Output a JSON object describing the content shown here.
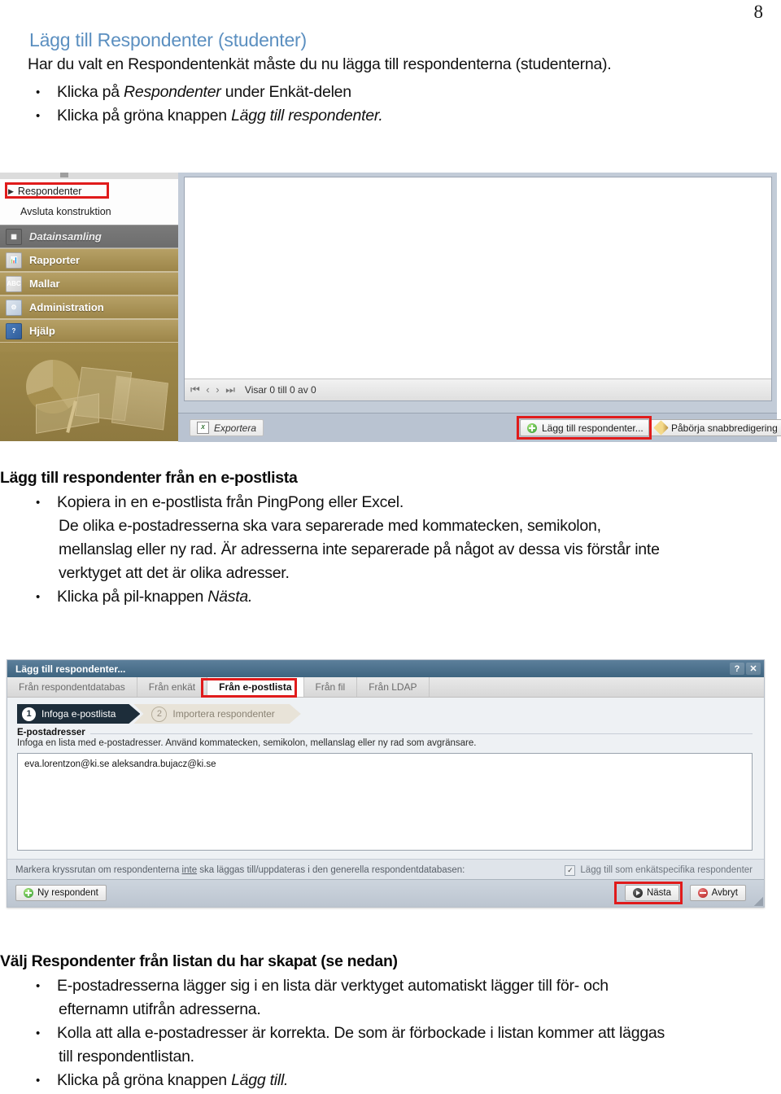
{
  "page": {
    "number": "8"
  },
  "doc": {
    "heading_blue": "Lägg till Respondenter (studenter)",
    "intro": "Har du valt en Respondentenkät måste du nu lägga till respondenterna (studenterna).",
    "bullet1_pre": "Klicka på ",
    "bullet1_italic": "Respondenter",
    "bullet1_post": "  under Enkät-delen",
    "bullet2_pre": "Klicka på gröna knappen ",
    "bullet2_italic": "Lägg till respondenter.",
    "section2_heading": "Lägg till respondenter från en e-postlista",
    "section2_b1": "Kopiera in en e-postlista från PingPong eller Excel.",
    "section2_b1_l2": "De olika e-postadresserna ska vara separerade med kommatecken, semikolon,",
    "section2_b1_l3": "mellanslag eller ny rad. Är adresserna inte separerade på något av dessa vis förstår inte",
    "section2_b1_l4": "verktyget att det är olika adresser.",
    "section2_b2_pre": "Klicka på pil-knappen ",
    "section2_b2_italic": "Nästa.",
    "section3_heading": "Välj Respondenter från listan du har skapat (se nedan)",
    "section3_b1_l1": "E-postadresserna lägger sig i en lista där verktyget automatiskt lägger till för- och",
    "section3_b1_l2": "efternamn utifrån adresserna.",
    "section3_b2_l1": "Kolla att alla e-postadresser är korrekta. De som är förbockade i listan kommer att läggas",
    "section3_b2_l2": "till respondentlistan.",
    "section3_b3_pre": "Klicka på gröna knappen ",
    "section3_b3_italic": "Lägg till."
  },
  "screenshot1": {
    "menu": {
      "respondenter": "Respondenter",
      "avsluta": "Avsluta konstruktion"
    },
    "sections": [
      {
        "label": "Datainsamling",
        "icon": "datacollection-icon"
      },
      {
        "label": "Rapporter",
        "icon": "reports-icon"
      },
      {
        "label": "Mallar",
        "icon": "templates-icon"
      },
      {
        "label": "Administration",
        "icon": "administration-icon"
      },
      {
        "label": "Hjälp",
        "icon": "help-icon"
      }
    ],
    "pager": {
      "first": "I⋘",
      "prev": "<",
      "next": ">",
      "last": "⋙I",
      "status": "Visar 0 till 0 av 0"
    },
    "toolbar": {
      "export": "Exportera",
      "add_respondents": "Lägg till respondenter...",
      "quick_edit": "Påbörja snabbredigering"
    }
  },
  "dialog": {
    "title": "Lägg till respondenter...",
    "help_btn": "?",
    "close_btn": "✕",
    "tabs": [
      {
        "label": "Från respondentdatabas",
        "active": false
      },
      {
        "label": "Från enkät",
        "active": false
      },
      {
        "label": "Från e-postlista",
        "active": true
      },
      {
        "label": "Från fil",
        "active": false
      },
      {
        "label": "Från LDAP",
        "active": false
      }
    ],
    "steps": [
      {
        "num": "1",
        "label": "Infoga e-postlista",
        "state": "current"
      },
      {
        "num": "2",
        "label": "Importera respondenter",
        "state": "pending"
      }
    ],
    "fieldset_label": "E-postadresser",
    "hint": "Infoga en lista med e-postadresser. Använd kommatecken, semikolon, mellanslag eller ny rad som avgränsare.",
    "textarea_value": "eva.lorentzon@ki.se\naleksandra.bujacz@ki.se",
    "checkbox_note_a": "Markera kryssrutan om respondenterna ",
    "checkbox_note_u": "inte",
    "checkbox_note_b": " ska läggas till/uppdateras i den generella respondentdatabasen:",
    "checkbox_label": "Lägg till som enkätspecifika respondenter",
    "checkbox_mark": "✓",
    "buttons": {
      "new_respondent": "Ny respondent",
      "next": "Nästa",
      "cancel": "Avbryt"
    }
  },
  "colors": {
    "heading_blue": "#5b8fc0",
    "highlight_red": "#e01b1b",
    "sidebar_gold": "#9d8748",
    "dialog_title": "#3f6580"
  }
}
